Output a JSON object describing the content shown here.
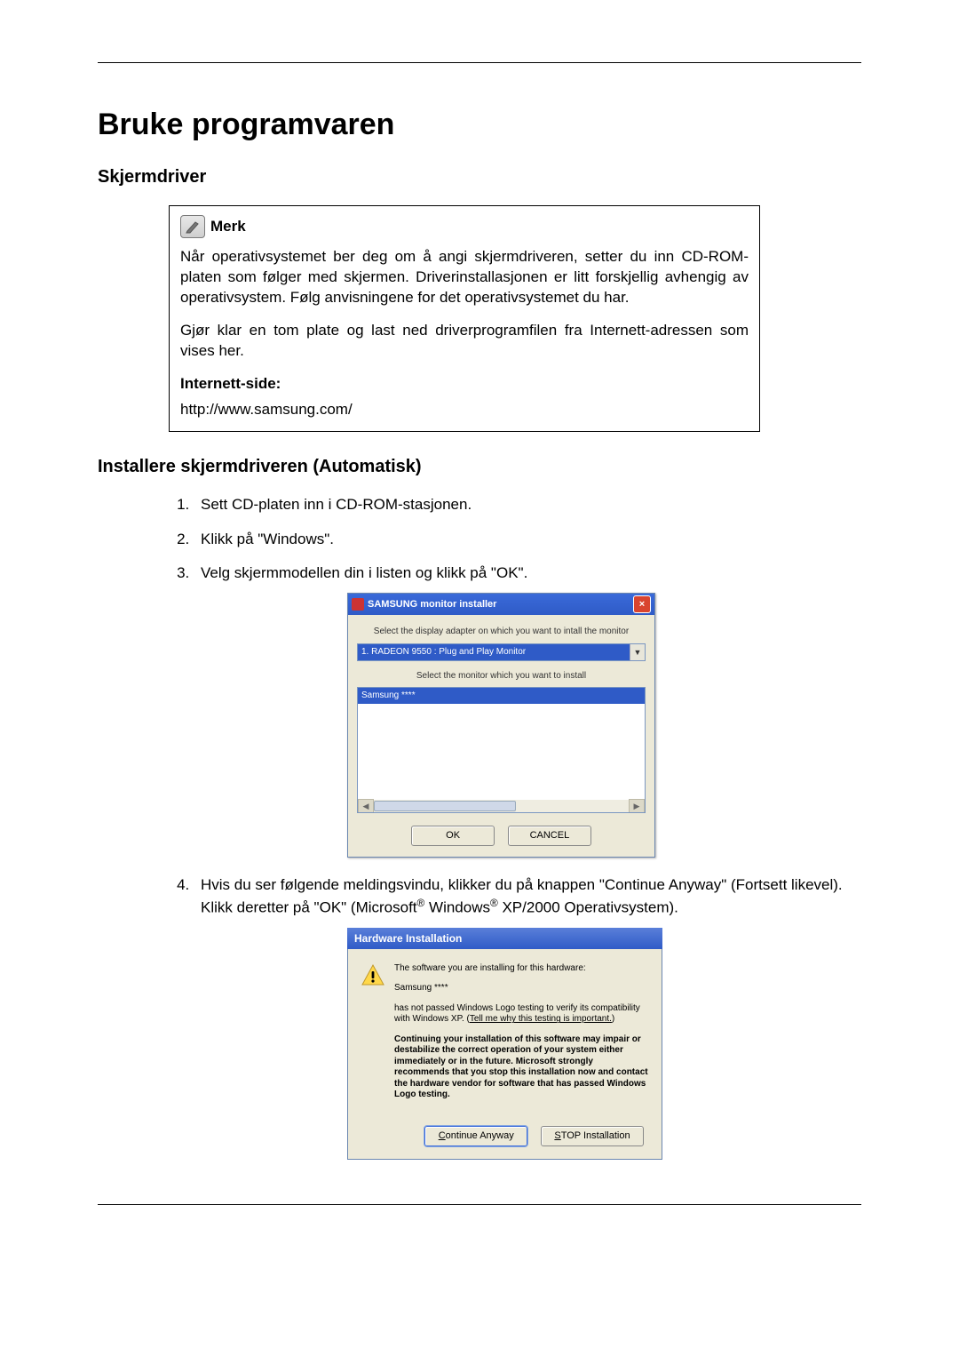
{
  "page": {
    "title": "Bruke programvaren",
    "section1": "Skjermdriver",
    "note_label": "Merk",
    "note_p1": "Når operativsystemet ber deg om å angi skjermdriveren, setter du inn CD-ROM-platen som følger med skjermen. Driverinstallasjonen er litt forskjellig avhengig av operativsystem. Følg anvisningene for det operativsystemet du har.",
    "note_p2": "Gjør klar en tom plate og last ned driverprogramfilen fra Internett-adressen som vises her.",
    "note_site_label": "Internett-side:",
    "note_url": "http://www.samsung.com/",
    "section2": "Installere skjermdriveren (Automatisk)"
  },
  "steps": {
    "s1": "Sett CD-platen inn i CD-ROM-stasjonen.",
    "s2": "Klikk på \"Windows\".",
    "s3": "Velg skjermmodellen din i listen og klikk på \"OK\".",
    "s4_a": "Hvis du ser følgende meldingsvindu, klikker du på knappen \"Continue Anyway\" (Fortsett likevel). Klikk deretter på \"OK\" (Microsoft",
    "s4_b": " Windows",
    "s4_c": " XP/2000 Operativsystem)."
  },
  "dlg1": {
    "title": "SAMSUNG monitor installer",
    "close_x": "×",
    "line1": "Select the display adapter on which you want to intall the monitor",
    "combo_value": "1. RADEON 9550 : Plug and Play Monitor",
    "line2": "Select the monitor which you want to install",
    "list_sel": "Samsung ****",
    "ok": "OK",
    "cancel": "CANCEL"
  },
  "dlg2": {
    "title": "Hardware Installation",
    "p1": "The software you are installing for this hardware:",
    "device": "Samsung ****",
    "p2a": "has not passed Windows Logo testing to verify its compatibility with Windows XP. (",
    "p2link": "Tell me why this testing is important.",
    "p2b": ")",
    "p3": "Continuing your installation of this software may impair or destabilize the correct operation of your system either immediately or in the future. Microsoft strongly recommends that you stop this installation now and contact the hardware vendor for software that has passed Windows Logo testing.",
    "btn_continue": "Continue Anyway",
    "btn_stop": "STOP Installation"
  }
}
